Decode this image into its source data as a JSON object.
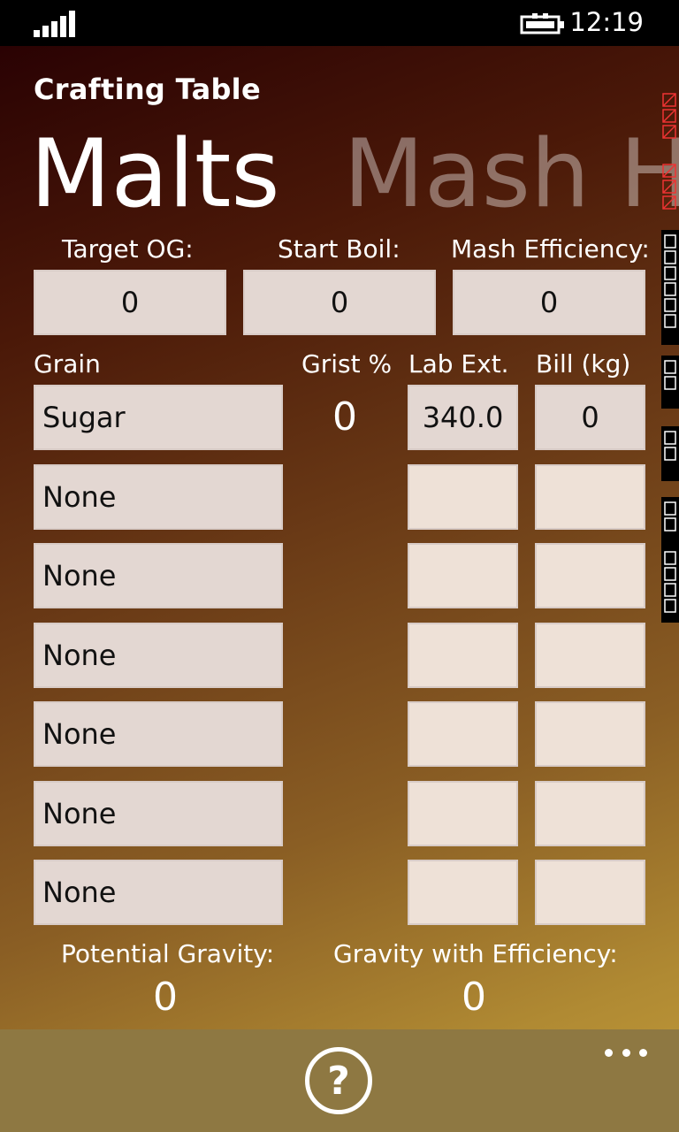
{
  "status": {
    "time": "12:19",
    "icons": [
      "signal-icon",
      "battery-charging-icon"
    ]
  },
  "app": {
    "title": "Crafting Table",
    "pivot": [
      {
        "label": "Malts",
        "active": true
      },
      {
        "label": "Mash Ho",
        "active": false
      }
    ]
  },
  "targets": {
    "target_og_label": "Target OG:",
    "target_og_value": "0",
    "start_boil_label": "Start Boil:",
    "start_boil_value": "0",
    "mash_efficiency_label": "Mash Efficiency:",
    "mash_efficiency_value": "0"
  },
  "grain_table": {
    "headers": {
      "grain": "Grain",
      "grist": "Grist %",
      "lab_ext": "Lab Ext.",
      "bill": "Bill (kg)"
    },
    "rows": [
      {
        "grain": "Sugar",
        "grist": "0",
        "lab_ext": "340.0",
        "bill": "0"
      },
      {
        "grain": "None",
        "grist": "",
        "lab_ext": "",
        "bill": ""
      },
      {
        "grain": "None",
        "grist": "",
        "lab_ext": "",
        "bill": ""
      },
      {
        "grain": "None",
        "grist": "",
        "lab_ext": "",
        "bill": ""
      },
      {
        "grain": "None",
        "grist": "",
        "lab_ext": "",
        "bill": ""
      },
      {
        "grain": "None",
        "grist": "",
        "lab_ext": "",
        "bill": ""
      },
      {
        "grain": "None",
        "grist": "",
        "lab_ext": "",
        "bill": ""
      }
    ]
  },
  "results": {
    "potential_gravity_label": "Potential Gravity:",
    "potential_gravity_value": "0",
    "gravity_efficiency_label": "Gravity with Efficiency:",
    "gravity_efficiency_value": "0"
  },
  "app_bar": {
    "help_icon": "question-circle-icon",
    "help_glyph": "?",
    "more_icon": "ellipsis-icon"
  },
  "colors": {
    "gradient_top": "#2a0203",
    "gradient_bottom": "#c29b3a",
    "textbox": "#e3d7d2",
    "app_bar": "#8e7842"
  }
}
